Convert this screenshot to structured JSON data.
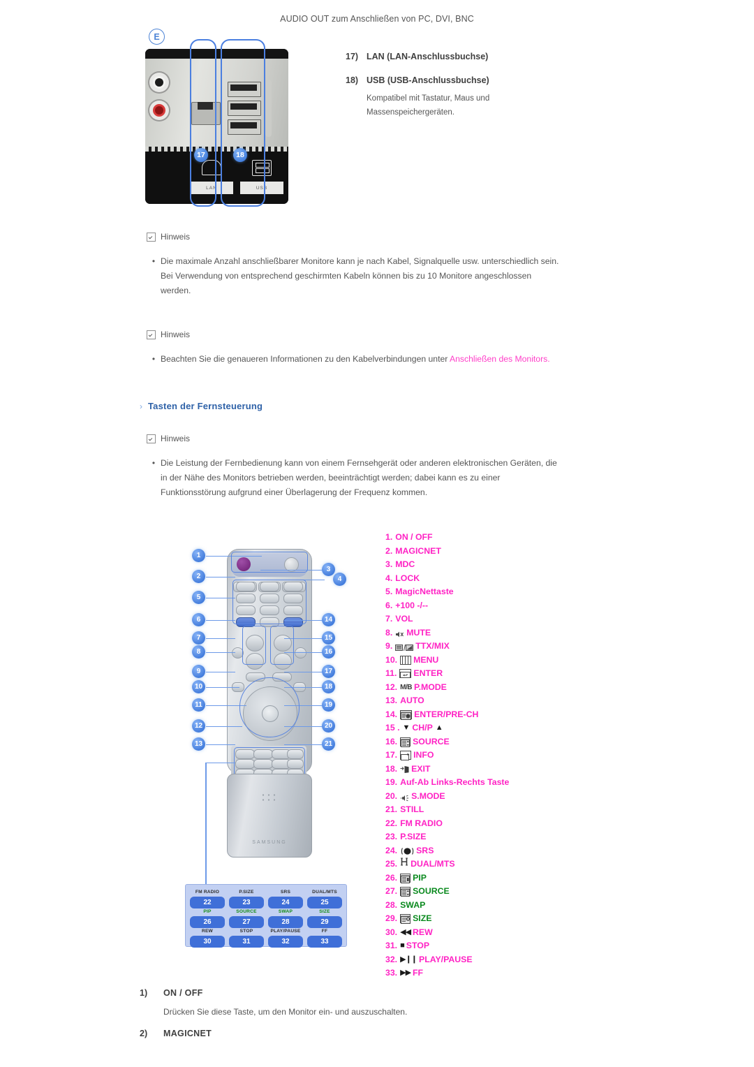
{
  "header": {
    "caption": "AUDIO OUT zum Anschließen von PC, DVI, BNC"
  },
  "connector_figure": {
    "badge": "E",
    "callouts": [
      {
        "num": "17",
        "icon_caption": "LAN"
      },
      {
        "num": "18",
        "icon_caption": "USB"
      }
    ]
  },
  "connector_items": [
    {
      "num": "17)",
      "label": "LAN (LAN-Anschlussbuchse)",
      "sub": ""
    },
    {
      "num": "18)",
      "label": "USB (USB-Anschlussbuchse)",
      "sub_line1": "Kompatibel mit Tastatur, Maus und",
      "sub_line2": "Massenspeichergeräten."
    }
  ],
  "notes": [
    {
      "title": "Hinweis",
      "bullets": [
        "Die maximale Anzahl anschließbarer Monitore kann je nach Kabel, Signalquelle usw. unterschiedlich sein. Bei Verwendung von entsprechend geschirmten Kabeln können bis zu 10 Monitore angeschlossen werden."
      ]
    },
    {
      "title": "Hinweis",
      "bullet_prefix": "Beachten Sie die genaueren Informationen zu den Kabelverbindungen unter ",
      "bullet_link": "Anschließen des Monitors."
    },
    {
      "title": "Hinweis",
      "bullets": [
        "Die Leistung der Fernbedienung kann von einem Fernsehgerät oder anderen elektronischen Geräten, die in der Nähe des Monitors betrieben werden, beeinträchtigt werden; dabei kann es zu einer Funktionsstörung aufgrund einer Überlagerung der Frequenz kommen."
      ]
    }
  ],
  "section_heading": {
    "arrow": "›",
    "title": "Tasten der Fernsteuerung"
  },
  "remote_callouts": [
    "1",
    "2",
    "3",
    "4",
    "5",
    "6",
    "7",
    "8",
    "9",
    "10",
    "11",
    "12",
    "13",
    "14",
    "15",
    "16",
    "17",
    "18",
    "19",
    "20",
    "21"
  ],
  "remote_legend": {
    "rows": [
      [
        {
          "cap": "FM RADIO",
          "num": "22",
          "green": false
        },
        {
          "cap": "P.SIZE",
          "num": "23",
          "green": false
        },
        {
          "cap": "SRS",
          "num": "24",
          "green": false
        },
        {
          "cap": "DUAL/MTS",
          "num": "25",
          "green": false
        }
      ],
      [
        {
          "cap": "PIP",
          "num": "26",
          "green": true
        },
        {
          "cap": "SOURCE",
          "num": "27",
          "green": true
        },
        {
          "cap": "SWAP",
          "num": "28",
          "green": true
        },
        {
          "cap": "SIZE",
          "num": "29",
          "green": true
        }
      ],
      [
        {
          "cap": "REW",
          "num": "30",
          "green": false
        },
        {
          "cap": "STOP",
          "num": "31",
          "green": false
        },
        {
          "cap": "PLAY/PAUSE",
          "num": "32",
          "green": false
        },
        {
          "cap": "FF",
          "num": "33",
          "green": false
        }
      ]
    ]
  },
  "remote_list": [
    {
      "num": "1.",
      "label": "ON / OFF",
      "icon": "",
      "green": false
    },
    {
      "num": "2.",
      "label": "MAGICNET",
      "icon": "",
      "green": false
    },
    {
      "num": "3.",
      "label": "MDC",
      "icon": "",
      "green": false
    },
    {
      "num": "4.",
      "label": "LOCK",
      "icon": "",
      "green": false
    },
    {
      "num": "5.",
      "label": "MagicNettaste",
      "icon": "",
      "green": false
    },
    {
      "num": "6.",
      "label": "+100 -/--",
      "icon": "",
      "green": false
    },
    {
      "num": "7.",
      "label": "VOL",
      "icon": "",
      "green": false
    },
    {
      "num": "8.",
      "label": "MUTE",
      "icon": "mute-icon",
      "green": false
    },
    {
      "num": "9.",
      "label": "TTX/MIX",
      "icon": "ttx-mix-icon",
      "green": false
    },
    {
      "num": "10.",
      "label": "MENU",
      "icon": "menu-icon",
      "green": false
    },
    {
      "num": "11.",
      "label": "ENTER",
      "icon": "enter-icon",
      "green": false
    },
    {
      "num": "12.",
      "label": "P.MODE",
      "icon": "mb-icon",
      "green": false
    },
    {
      "num": "13.",
      "label": "AUTO",
      "icon": "",
      "green": false
    },
    {
      "num": "14.",
      "label": "ENTER/PRE-CH",
      "icon": "pre-ch-icon",
      "green": false
    },
    {
      "num": "15 .",
      "label": "CH/P",
      "icon": "ch-p-icon",
      "green": false
    },
    {
      "num": "16.",
      "label": "SOURCE",
      "icon": "source-icon",
      "green": false
    },
    {
      "num": "17.",
      "label": "INFO",
      "icon": "info-icon",
      "green": false
    },
    {
      "num": "18.",
      "label": "EXIT",
      "icon": "exit-icon",
      "green": false
    },
    {
      "num": "19.",
      "label": "Auf-Ab Links-Rechts Taste",
      "icon": "",
      "green": false
    },
    {
      "num": "20.",
      "label": "S.MODE",
      "icon": "s-mode-icon",
      "green": false
    },
    {
      "num": "21.",
      "label": "STILL",
      "icon": "",
      "green": false
    },
    {
      "num": "22.",
      "label": "FM RADIO",
      "icon": "",
      "green": false
    },
    {
      "num": "23.",
      "label": "P.SIZE",
      "icon": "",
      "green": false
    },
    {
      "num": "24.",
      "label": "SRS",
      "icon": "srs-icon",
      "green": false
    },
    {
      "num": "25.",
      "label": "DUAL/MTS",
      "icon": "dual-mts-icon",
      "green": false
    },
    {
      "num": "26.",
      "label": "PIP",
      "icon": "pip-icon",
      "green": true
    },
    {
      "num": "27.",
      "label": "SOURCE",
      "icon": "source-icon",
      "green": true
    },
    {
      "num": "28.",
      "label": "SWAP",
      "icon": "",
      "green": true
    },
    {
      "num": "29.",
      "label": "SIZE",
      "icon": "size-icon",
      "green": true
    },
    {
      "num": "30.",
      "label": "REW",
      "icon": "rew-icon",
      "green": false
    },
    {
      "num": "31.",
      "label": "STOP",
      "icon": "stop-icon",
      "green": false
    },
    {
      "num": "32.",
      "label": "PLAY/PAUSE",
      "icon": "play-pause-icon",
      "green": false
    },
    {
      "num": "33.",
      "label": "FF",
      "icon": "ff-icon",
      "green": false
    }
  ],
  "bottom_items": [
    {
      "num": "1)",
      "label": "ON / OFF",
      "desc": "Drücken Sie diese Taste, um den Monitor ein- und auszuschalten."
    },
    {
      "num": "2)",
      "label": "MAGICNET",
      "desc": ""
    }
  ],
  "colors": {
    "magenta": "#ff22c4",
    "green": "#0b8a1f",
    "heading_blue": "#2f62a8",
    "callout_blue": "#2a68d2",
    "body_gray": "#555555"
  }
}
